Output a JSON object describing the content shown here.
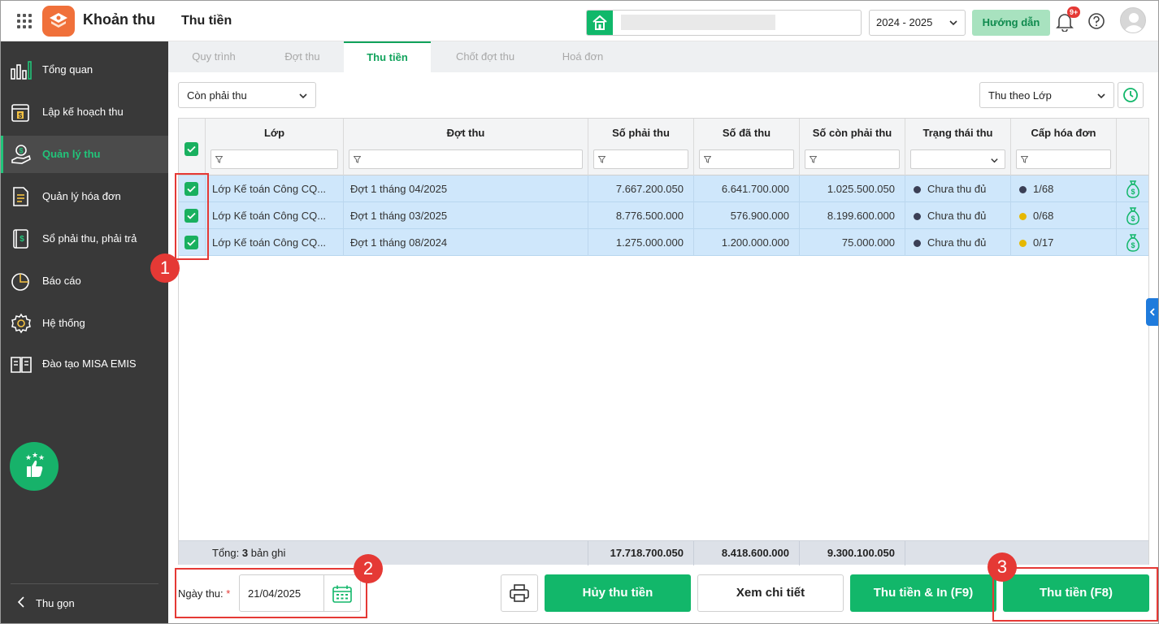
{
  "app": {
    "name": "Khoản thu",
    "page_title": "Thu tiền",
    "school_year": "2024 - 2025",
    "guide_button": "Hướng dẫn",
    "notification_badge": "9+"
  },
  "sidebar": {
    "items": [
      {
        "label": "Tổng quan",
        "icon": "bar-chart-icon"
      },
      {
        "label": "Lập kế hoạch thu",
        "icon": "calendar-dollar-icon"
      },
      {
        "label": "Quản lý thu",
        "icon": "money-hand-icon",
        "active": true
      },
      {
        "label": "Quản lý hóa đơn",
        "icon": "document-icon"
      },
      {
        "label": "Sổ phải thu, phải trả",
        "icon": "ledger-icon"
      },
      {
        "label": "Báo cáo",
        "icon": "pie-chart-icon"
      },
      {
        "label": "Hệ thống",
        "icon": "gear-icon"
      },
      {
        "label": "Đào tạo MISA EMIS",
        "icon": "book-icon"
      }
    ],
    "collapse_label": "Thu gọn"
  },
  "tabs": [
    "Quy trình",
    "Đợt thu",
    "Thu tiền",
    "Chốt đợt thu",
    "Hoá đơn"
  ],
  "active_tab": 2,
  "filters": {
    "status_filter": "Còn phải thu",
    "group_by": "Thu theo Lớp"
  },
  "table": {
    "columns": [
      "Lớp",
      "Đợt thu",
      "Số phải thu",
      "Số đã thu",
      "Số còn phải thu",
      "Trạng thái thu",
      "Cấp hóa đơn"
    ],
    "rows": [
      {
        "lop": "Lớp Kế toán Công CQ...",
        "dot_thu": "Đợt 1 tháng 04/2025",
        "so_phai_thu": "7.667.200.050",
        "so_da_thu": "6.641.700.000",
        "so_con_phai_thu": "1.025.500.050",
        "trang_thai": "Chưa thu đủ",
        "cap_hoa_don": "1/68",
        "invoice_dot_color": "#3b3f55"
      },
      {
        "lop": "Lớp Kế toán Công CQ...",
        "dot_thu": "Đợt 1 tháng 03/2025",
        "so_phai_thu": "8.776.500.000",
        "so_da_thu": "576.900.000",
        "so_con_phai_thu": "8.199.600.000",
        "trang_thai": "Chưa thu đủ",
        "cap_hoa_don": "0/68",
        "invoice_dot_color": "#e6b800"
      },
      {
        "lop": "Lớp Kế toán Công CQ...",
        "dot_thu": "Đợt 1 tháng 08/2024",
        "so_phai_thu": "1.275.000.000",
        "so_da_thu": "1.200.000.000",
        "so_con_phai_thu": "75.000.000",
        "trang_thai": "Chưa thu đủ",
        "cap_hoa_don": "0/17",
        "invoice_dot_color": "#e6b800"
      }
    ],
    "footer": {
      "label": "Tổng:",
      "count": "3",
      "suffix": "bản ghi",
      "so_phai_thu": "17.718.700.050",
      "so_da_thu": "8.418.600.000",
      "so_con_phai_thu": "9.300.100.050"
    }
  },
  "bottom": {
    "date_label": "Ngày thu:",
    "required_mark": "*",
    "date_value": "21/04/2025",
    "buttons": {
      "cancel": "Hủy thu tiền",
      "view": "Xem chi tiết",
      "collect_print": "Thu tiền & In (F9)",
      "collect": "Thu tiền (F8)"
    }
  },
  "annotations": [
    "1",
    "2",
    "3"
  ],
  "colors": {
    "accent": "#12b76a",
    "sidebar_bg": "#393939",
    "selected_row": "#cfe7fb",
    "annotation": "#e53935"
  }
}
